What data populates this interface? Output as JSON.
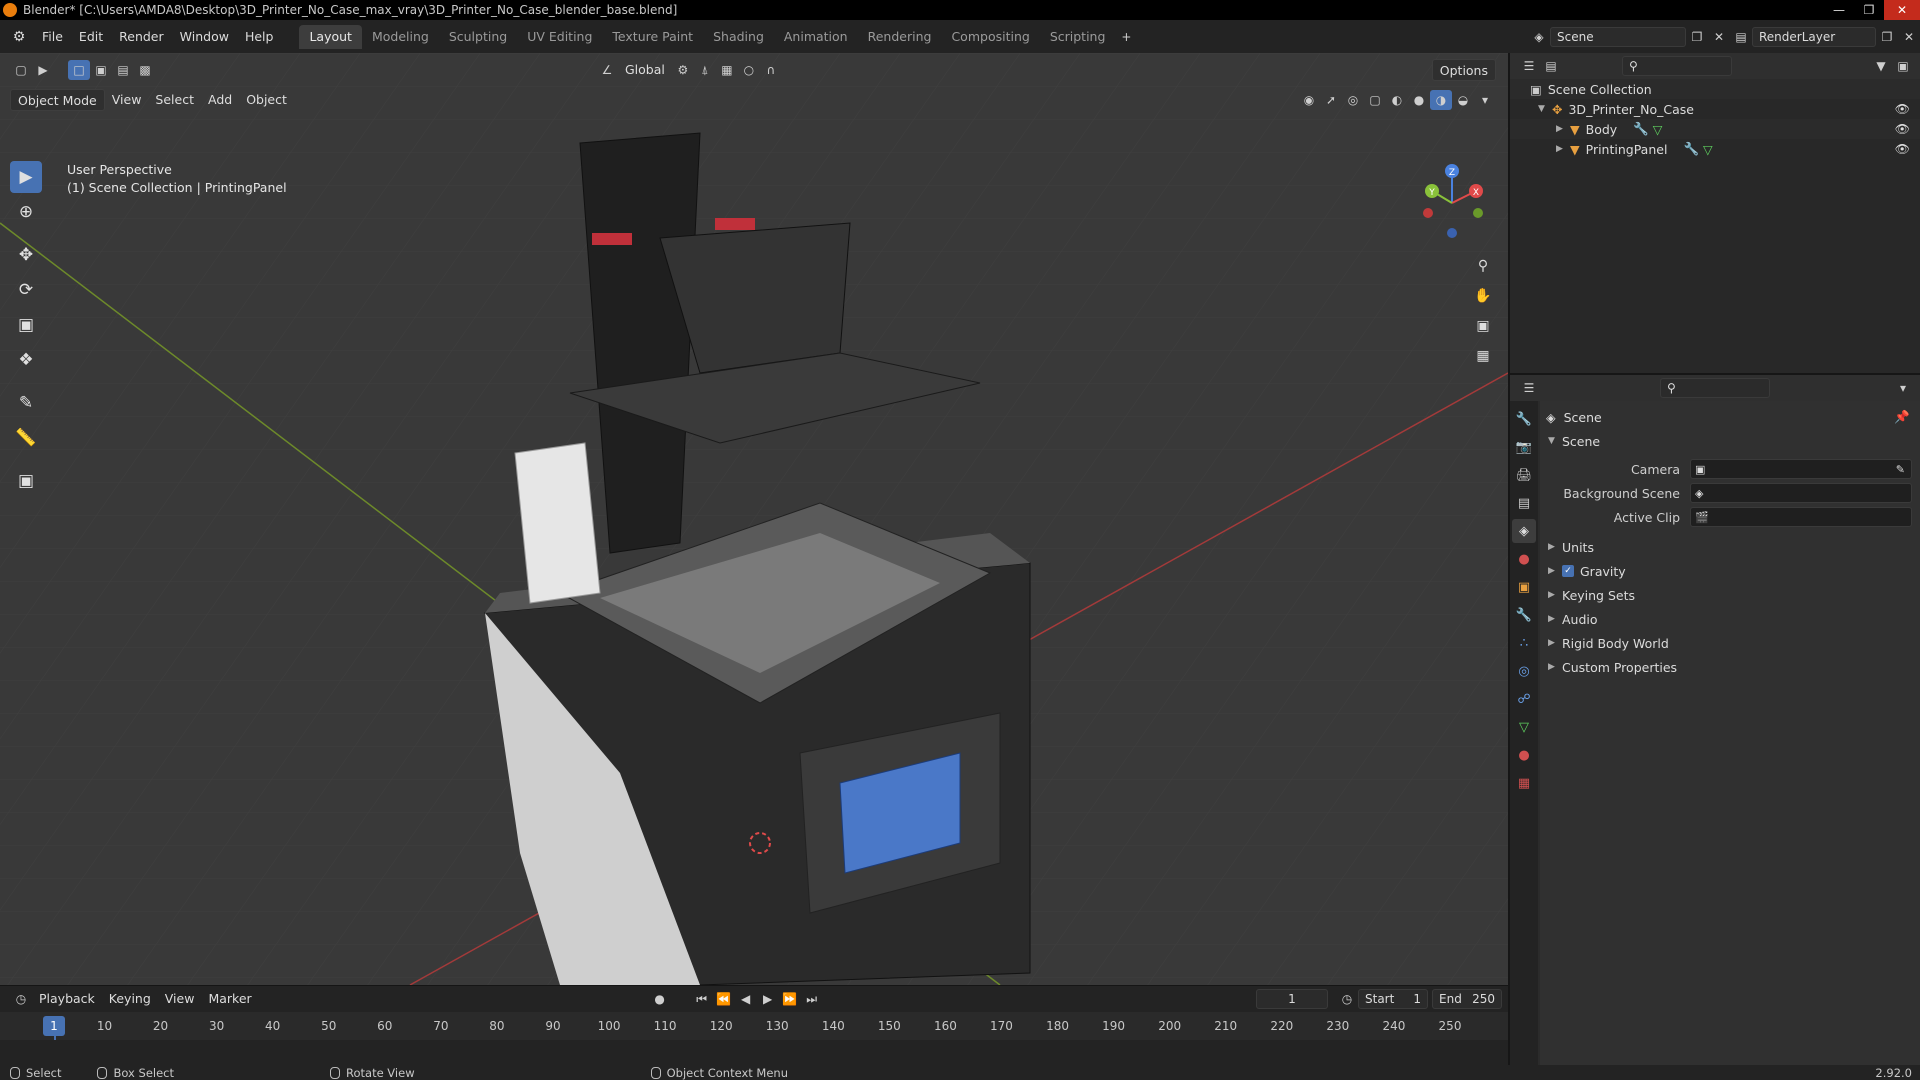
{
  "window": {
    "title": "Blender* [C:\\Users\\AMDA8\\Desktop\\3D_Printer_No_Case_max_vray\\3D_Printer_No_Case_blender_base.blend]"
  },
  "menus": [
    "File",
    "Edit",
    "Render",
    "Window",
    "Help"
  ],
  "workspaces": [
    "Layout",
    "Modeling",
    "Sculpting",
    "UV Editing",
    "Texture Paint",
    "Shading",
    "Animation",
    "Rendering",
    "Compositing",
    "Scripting"
  ],
  "active_workspace": "Layout",
  "scene_selector": {
    "scene": "Scene",
    "view_layer": "RenderLayer"
  },
  "viewport": {
    "mode": "Object Mode",
    "header_menus": [
      "View",
      "Select",
      "Add",
      "Object"
    ],
    "transform_orientation": "Global",
    "options_label": "Options",
    "info_line1": "User Perspective",
    "info_line2": "(1) Scene Collection | PrintingPanel",
    "gizmo_axes": {
      "x": "X",
      "y": "Y",
      "z": "Z"
    }
  },
  "tools": [
    "select-box",
    "cursor",
    "move",
    "rotate",
    "scale",
    "transform",
    "annotate",
    "measure",
    "add-cube"
  ],
  "outliner": {
    "root": "Scene Collection",
    "collection": "3D_Printer_No_Case",
    "objects": [
      "Body",
      "PrintingPanel"
    ]
  },
  "properties": {
    "context_title": "Scene",
    "panel_title": "Scene",
    "fields": {
      "camera": "Camera",
      "background_scene": "Background Scene",
      "active_clip": "Active Clip"
    },
    "panels": [
      "Units",
      "Gravity",
      "Keying Sets",
      "Audio",
      "Rigid Body World",
      "Custom Properties"
    ],
    "gravity_checked": true
  },
  "timeline": {
    "menus": [
      "Playback",
      "Keying",
      "View",
      "Marker"
    ],
    "current_frame": "1",
    "start_label": "Start",
    "start": "1",
    "end_label": "End",
    "end": "250",
    "ticks": [
      "1",
      "10",
      "20",
      "30",
      "40",
      "50",
      "60",
      "70",
      "80",
      "90",
      "100",
      "110",
      "120",
      "130",
      "140",
      "150",
      "160",
      "170",
      "180",
      "190",
      "200",
      "210",
      "220",
      "230",
      "240",
      "250"
    ]
  },
  "statusbar": {
    "select": "Select",
    "box_select": "Box Select",
    "rotate_view": "Rotate View",
    "context_menu": "Object Context Menu",
    "version": "2.92.0"
  },
  "colors": {
    "accent": "#4772b3",
    "x_axis": "#e04a4a",
    "y_axis": "#8ac23a",
    "z_axis": "#4a82e0"
  }
}
